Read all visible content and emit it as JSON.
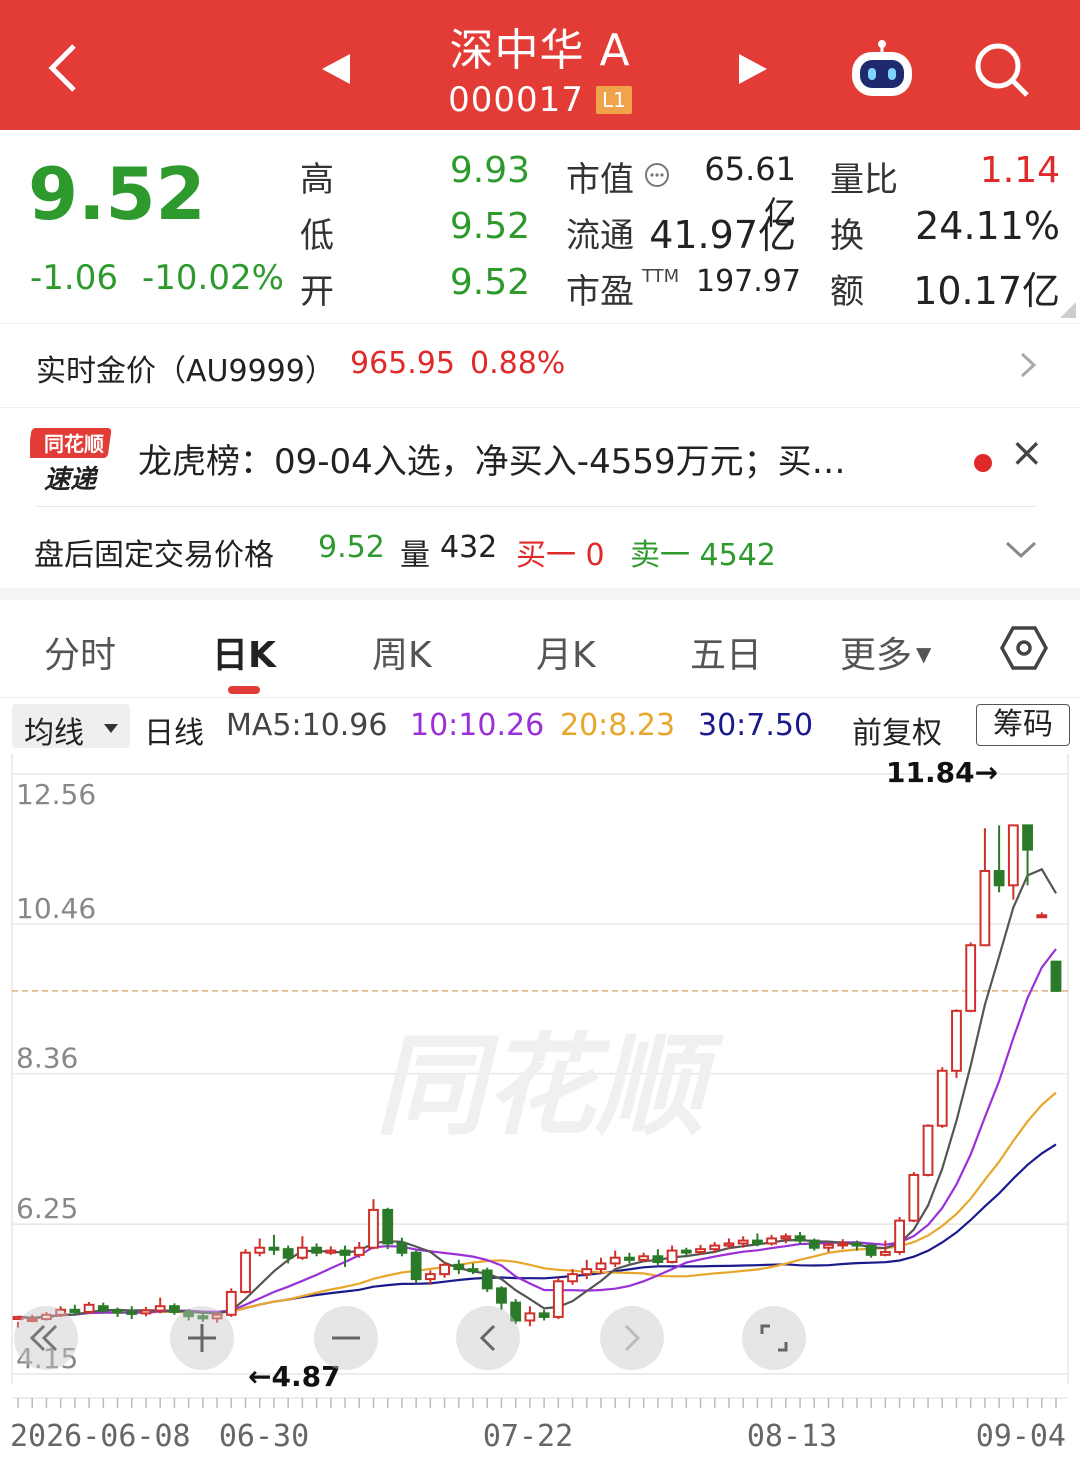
{
  "header": {
    "title": "深中华 A",
    "code": "000017",
    "level_badge": "L1",
    "bg_color": "#e33b35"
  },
  "quote": {
    "price": "9.52",
    "change": "-1.06",
    "change_pct": "-10.02%",
    "high_label": "高",
    "high": "9.93",
    "low_label": "低",
    "low": "9.52",
    "open_label": "开",
    "open": "9.52",
    "mktcap_label": "市值",
    "mktcap": "65.61亿",
    "float_label": "流通",
    "float": "41.97亿",
    "pe_label": "市盈",
    "pe_sup": "TTM",
    "pe": "197.97",
    "vol_ratio_label": "量比",
    "vol_ratio": "1.14",
    "turnover_label": "换",
    "turnover": "24.11%",
    "amount_label": "额",
    "amount": "10.17亿"
  },
  "gold": {
    "label": "实时金价（AU9999）",
    "price": "965.95",
    "pct": "0.88%"
  },
  "news": {
    "logo_top": "同花顺",
    "logo_bottom": "速递",
    "text": "龙虎榜：09-04入选，净买入-4559万元；买…"
  },
  "after_hours": {
    "label": "盘后固定交易价格",
    "price": "9.52",
    "vol_label": "量",
    "vol": "432",
    "bid": "买一 0",
    "ask": "卖一 4542"
  },
  "tabs": [
    "分时",
    "日K",
    "周K",
    "月K",
    "五日",
    "更多"
  ],
  "active_tab": "日K",
  "indicators": {
    "selector": "均线",
    "period": "日线",
    "ma5": "MA5:10.96",
    "ma10": "10:10.26",
    "ma20": "20:8.23",
    "ma30": "30:7.50",
    "adjust": "前复权",
    "chips": "筹码",
    "ma_colors": {
      "ma5": "#555555",
      "ma10": "#9b30d9",
      "ma20": "#e8a72c",
      "ma30": "#1a1a8c"
    }
  },
  "chart_data": {
    "type": "candlestick",
    "y_ticks": [
      "12.56",
      "10.46",
      "8.36",
      "6.25",
      "4.15"
    ],
    "ylim": [
      4.15,
      12.56
    ],
    "x_ticks": [
      "2026-06-08",
      "06-30",
      "07-22",
      "08-13",
      "09-04"
    ],
    "max_label": "11.84→",
    "min_label": "←4.87",
    "last_price_line": 9.52,
    "watermark": "同花顺",
    "up_color": "#d0302a",
    "down_color": "#2a7a2a",
    "candles": [
      [
        4.92,
        4.95,
        4.88,
        4.8
      ],
      [
        4.9,
        4.92,
        4.98,
        4.88
      ],
      [
        4.92,
        4.98,
        5.02,
        4.9
      ],
      [
        4.98,
        5.05,
        5.1,
        4.95
      ],
      [
        5.05,
        5.02,
        5.12,
        4.98
      ],
      [
        5.02,
        5.12,
        5.16,
        5.0
      ],
      [
        5.1,
        5.04,
        5.15,
        5.0
      ],
      [
        5.04,
        5.02,
        5.08,
        4.95
      ],
      [
        5.02,
        5.0,
        5.1,
        4.92
      ],
      [
        5.0,
        5.04,
        5.09,
        4.96
      ],
      [
        5.04,
        5.1,
        5.22,
        5.0
      ],
      [
        5.1,
        5.02,
        5.14,
        4.98
      ],
      [
        5.02,
        4.96,
        5.06,
        4.9
      ],
      [
        4.96,
        4.93,
        5.0,
        4.88
      ],
      [
        4.93,
        4.98,
        5.02,
        4.87
      ],
      [
        4.98,
        5.3,
        5.35,
        4.95
      ],
      [
        5.3,
        5.85,
        5.9,
        5.28
      ],
      [
        5.85,
        5.92,
        6.05,
        5.8
      ],
      [
        5.92,
        5.9,
        6.1,
        5.82
      ],
      [
        5.9,
        5.78,
        5.95,
        5.7
      ],
      [
        5.78,
        5.92,
        6.08,
        5.75
      ],
      [
        5.92,
        5.85,
        5.98,
        5.8
      ],
      [
        5.85,
        5.88,
        5.94,
        5.82
      ],
      [
        5.88,
        5.82,
        5.95,
        5.65
      ],
      [
        5.82,
        5.92,
        6.0,
        5.78
      ],
      [
        5.92,
        6.45,
        6.6,
        5.9
      ],
      [
        6.45,
        5.98,
        6.48,
        5.9
      ],
      [
        5.98,
        5.85,
        6.06,
        5.8
      ],
      [
        5.85,
        5.48,
        5.88,
        5.42
      ],
      [
        5.48,
        5.55,
        5.6,
        5.4
      ],
      [
        5.55,
        5.68,
        5.72,
        5.5
      ],
      [
        5.68,
        5.62,
        5.75,
        5.55
      ],
      [
        5.62,
        5.6,
        5.7,
        5.55
      ],
      [
        5.6,
        5.35,
        5.64,
        5.3
      ],
      [
        5.35,
        5.15,
        5.38,
        5.05
      ],
      [
        5.15,
        4.9,
        5.2,
        4.85
      ],
      [
        4.9,
        5.0,
        5.1,
        4.82
      ],
      [
        5.0,
        4.95,
        5.05,
        4.9
      ],
      [
        4.95,
        5.45,
        5.5,
        4.92
      ],
      [
        5.45,
        5.55,
        5.62,
        5.4
      ],
      [
        5.55,
        5.62,
        5.75,
        5.48
      ],
      [
        5.62,
        5.7,
        5.78,
        5.55
      ],
      [
        5.7,
        5.78,
        5.88,
        5.65
      ],
      [
        5.78,
        5.75,
        5.85,
        5.7
      ],
      [
        5.75,
        5.8,
        5.85,
        5.72
      ],
      [
        5.8,
        5.72,
        5.9,
        5.68
      ],
      [
        5.72,
        5.88,
        5.95,
        5.7
      ],
      [
        5.88,
        5.86,
        5.92,
        5.8
      ],
      [
        5.86,
        5.9,
        5.96,
        5.82
      ],
      [
        5.9,
        5.95,
        6.0,
        5.85
      ],
      [
        5.95,
        5.98,
        6.05,
        5.9
      ],
      [
        5.98,
        6.02,
        6.08,
        5.92
      ],
      [
        6.02,
        5.98,
        6.12,
        5.94
      ],
      [
        5.98,
        6.05,
        6.1,
        5.95
      ],
      [
        6.05,
        6.08,
        6.12,
        5.98
      ],
      [
        6.08,
        6.02,
        6.14,
        5.96
      ],
      [
        6.02,
        5.92,
        6.05,
        5.88
      ],
      [
        5.92,
        5.96,
        6.0,
        5.86
      ],
      [
        5.96,
        5.98,
        6.04,
        5.9
      ],
      [
        5.98,
        5.95,
        6.02,
        5.88
      ],
      [
        5.95,
        5.82,
        5.98,
        5.78
      ],
      [
        5.82,
        5.86,
        6.02,
        5.8
      ],
      [
        5.86,
        6.3,
        6.35,
        5.82
      ],
      [
        6.3,
        6.94,
        6.98,
        6.28
      ],
      [
        6.94,
        7.63,
        7.65,
        6.92
      ],
      [
        7.63,
        8.4,
        8.45,
        7.6
      ],
      [
        8.4,
        9.24,
        9.26,
        8.3
      ],
      [
        9.24,
        10.16,
        10.2,
        9.22
      ],
      [
        10.16,
        11.2,
        11.8,
        10.2
      ],
      [
        11.2,
        11.0,
        11.84,
        10.9
      ],
      [
        11.0,
        11.84,
        11.84,
        10.8
      ],
      [
        11.84,
        11.5,
        11.84,
        11.0
      ],
      [
        10.58,
        10.58,
        10.62,
        10.55
      ],
      [
        9.93,
        9.52,
        9.93,
        9.52
      ]
    ]
  }
}
